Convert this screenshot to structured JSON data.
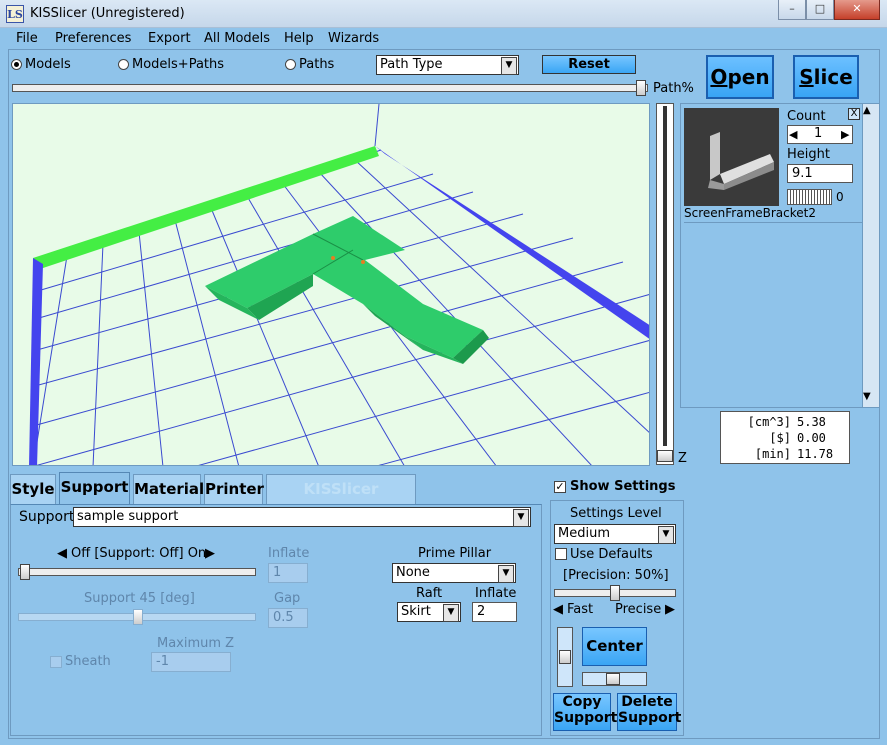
{
  "window": {
    "title": "KISSlicer (Unregistered)",
    "icon_letters": "LS",
    "minimize": "–",
    "maximize": "□",
    "close": "✕"
  },
  "menu": [
    "File",
    "Preferences",
    "Export",
    "All Models",
    "Help",
    "Wizards"
  ],
  "view_modes": {
    "models": "Models",
    "models_paths": "Models+Paths",
    "paths": "Paths",
    "selected": "Models"
  },
  "path_type": {
    "value": "Path Type"
  },
  "buttons": {
    "reset": "Reset",
    "open": "Open",
    "slice": "Slice",
    "center": "Center",
    "copy_support": [
      "Copy",
      "Support"
    ],
    "delete_support": [
      "Delete",
      "Support"
    ]
  },
  "path_percent_label": "Path%",
  "z_label": "Z",
  "model_panel": {
    "close": "X",
    "count_label": "Count",
    "count_value": "1",
    "height_label": "Height",
    "height_value": "9.1",
    "rotation_value": "0",
    "model_name": "ScreenFrameBracket2"
  },
  "stats": [
    {
      "unit": "[cm^3]",
      "value": "5.38"
    },
    {
      "unit": "[$]",
      "value": "0.00"
    },
    {
      "unit": "[min]",
      "value": "11.78"
    }
  ],
  "tabs": [
    {
      "label": "Style",
      "state": "normal"
    },
    {
      "label": "Support",
      "state": "active"
    },
    {
      "label": "Material",
      "state": "normal"
    },
    {
      "label": "Printer",
      "state": "normal"
    },
    {
      "label": "KISSlicer Internals",
      "state": "disabled"
    }
  ],
  "support": {
    "label": "Support",
    "profile": "sample support",
    "toggle_label": "Off [Support: Off] On",
    "inflate_label": "Inflate",
    "inflate_value": "1",
    "support45_label": "Support 45 [deg]",
    "gap_label": "Gap",
    "gap_value": "0.5",
    "sheath_label": "Sheath",
    "maxz_label": "Maximum Z",
    "maxz_value": "-1",
    "prime_pillar_label": "Prime Pillar",
    "prime_pillar_value": "None",
    "raft_label": "Raft",
    "raft_value": "Skirt",
    "raft_inflate_label": "Inflate",
    "raft_inflate_value": "2"
  },
  "settings": {
    "show_settings_label": "Show Settings",
    "show_settings_checked": true,
    "level_label": "Settings Level",
    "level_value": "Medium",
    "use_defaults_label": "Use Defaults",
    "precision_label": "[Precision: 50%]",
    "fast_label": "Fast",
    "precise_label": "Precise"
  },
  "colors": {
    "bg": "#8fc3ea",
    "viewport_bg": "#e8fbe8",
    "model": "#2ecc6b",
    "bed_edge_green": "#44ee44",
    "bed_edge_blue": "#4444ee",
    "grid": "#3a4ad0"
  }
}
